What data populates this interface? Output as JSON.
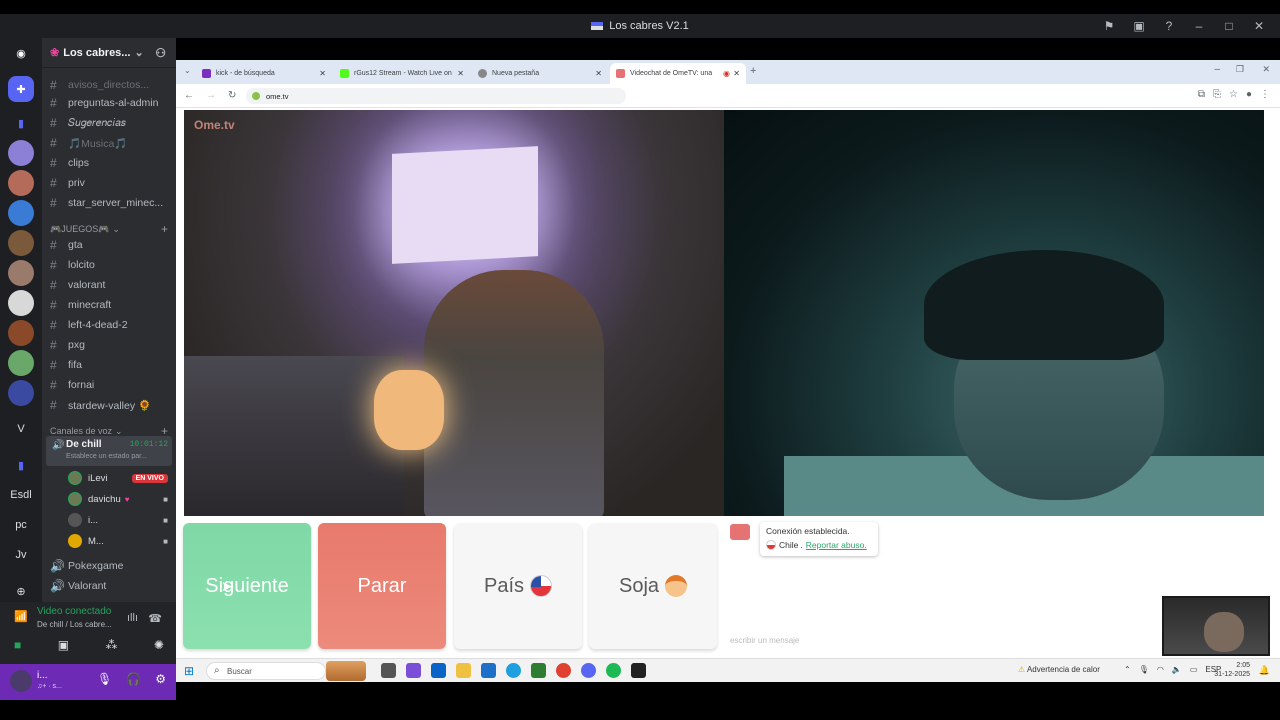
{
  "window": {
    "title": "Los cabres V2.1"
  },
  "server": {
    "name": "Los cabres..."
  },
  "channels": [
    {
      "name": "avisos_directos...",
      "dim": true
    },
    {
      "name": "preguntas-al-admin"
    },
    {
      "name": "𝑆𝑢𝑔𝑒𝑟𝑒𝑛𝑐𝑖𝑎𝑠"
    },
    {
      "name": "🎵Musica🎵",
      "dim": true
    },
    {
      "name": "clips"
    },
    {
      "name": "priv"
    },
    {
      "name": "star_server_minec..."
    }
  ],
  "games_category": "🎮JUEGOS🎮",
  "game_channels": [
    "gta",
    "lolcito",
    "valorant",
    "minecraft",
    "left-4-dead-2",
    "pxg",
    "fifa",
    "fornai",
    "stardew-valley 🌻"
  ],
  "voice_category": "Canales de voz",
  "voice_channel": {
    "name": "De chill",
    "time": "10:01:12",
    "status": "Establece un estado par..."
  },
  "voice_users": [
    {
      "name": "iLevi",
      "badge": "EN VIVO"
    },
    {
      "name": "davichu"
    },
    {
      "name": "i..."
    },
    {
      "name": "M..."
    }
  ],
  "other_voice": [
    "Pokexgame",
    "Valorant"
  ],
  "rail_labels": [
    "V",
    "Esdl",
    "pc",
    "Jv"
  ],
  "voice_panel": {
    "label": "Video conectado",
    "sub": "De chill / Los cabre..."
  },
  "user_panel": {
    "name": "i...",
    "status": "♫+ · s..."
  },
  "browser": {
    "tabs": [
      {
        "label": "kick - de búsqueda",
        "color": "#7b2fbe"
      },
      {
        "label": "rGus12 Stream - Watch Live on",
        "color": "#53fc18"
      },
      {
        "label": "Nueva pestaña",
        "color": "#888"
      },
      {
        "label": "Videochat de OmeTV: una",
        "color": "#e57373"
      }
    ],
    "url": "ome.tv"
  },
  "ometv": {
    "logo": "Ome.tv",
    "buttons": {
      "next": "Siguiente",
      "stop": "Parar",
      "country": "País",
      "gender": "Soja"
    },
    "chat": {
      "connected": "Conexión establecida.",
      "country": "Chile",
      "report": "Reportar abuso.",
      "placeholder": "escribir un mensaje"
    }
  },
  "taskbar": {
    "search": "Buscar",
    "weather": "Advertencia de calor",
    "lang": "ESP",
    "time": "2:05",
    "date": "31-12-2025"
  }
}
